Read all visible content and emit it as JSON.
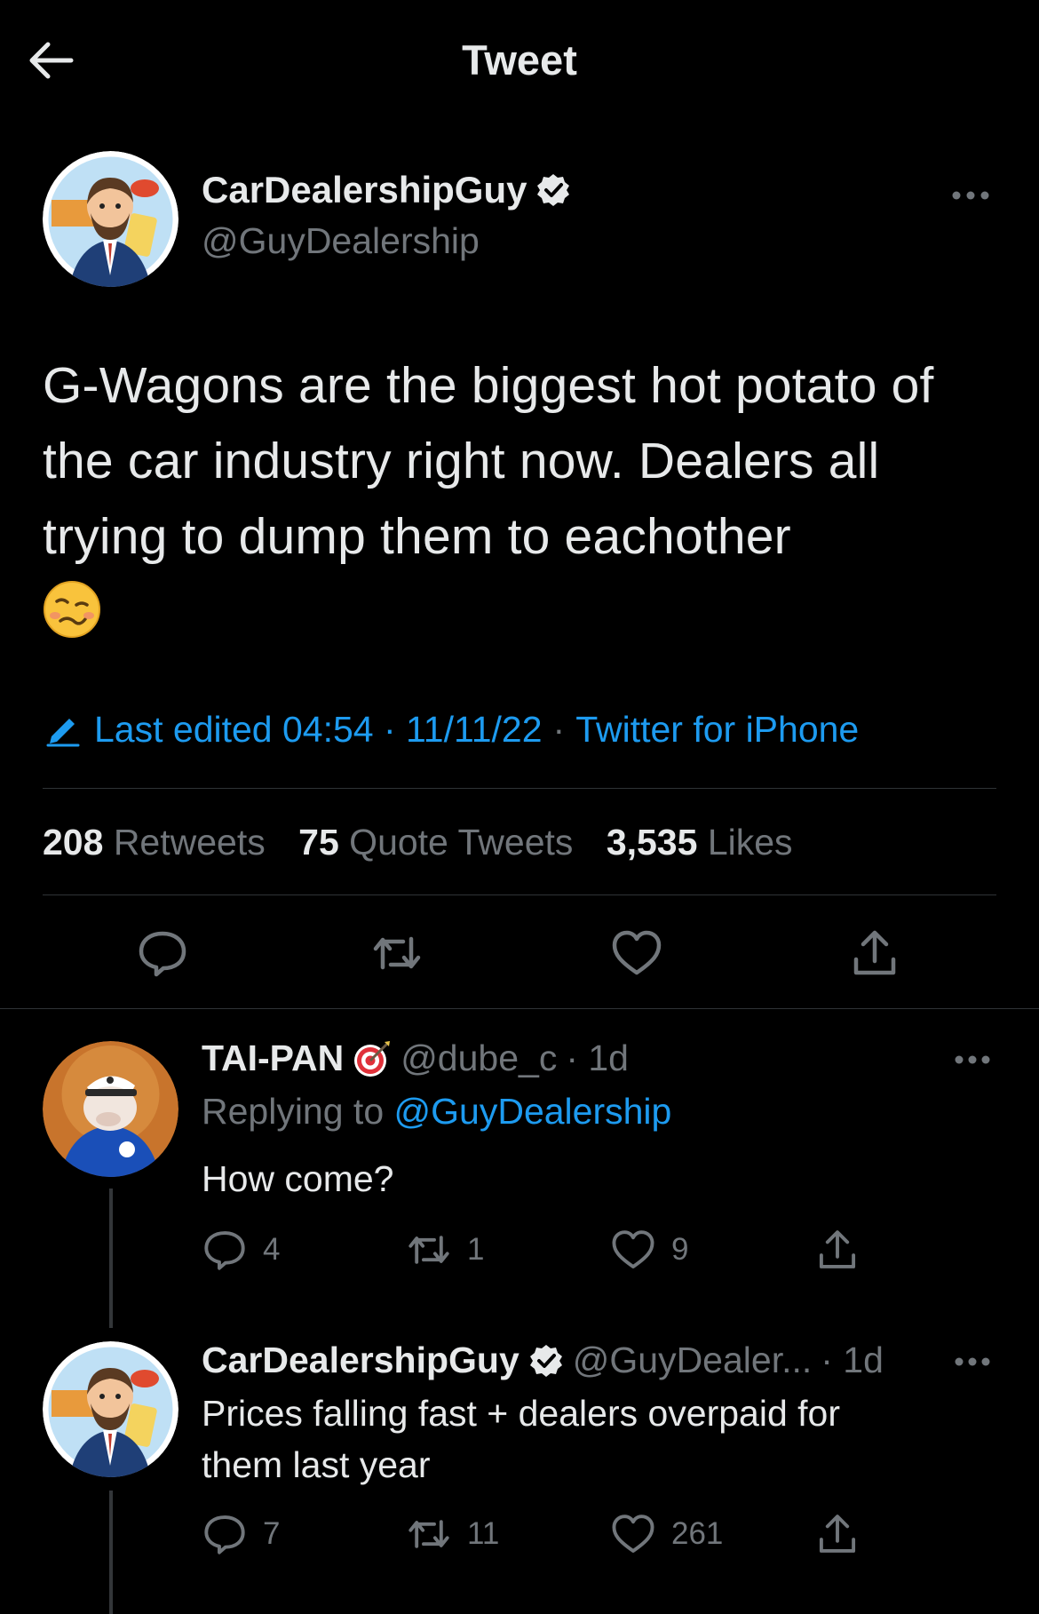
{
  "header": {
    "title": "Tweet"
  },
  "main_tweet": {
    "author_name": "CarDealershipGuy",
    "author_handle": "@GuyDealership",
    "verified": true,
    "text": "G-Wagons are the biggest hot potato of the car industry right now. Dealers all trying to dump them to eachother",
    "emoji": "woozy-face",
    "edited_label": "Last edited 04:54 · 11/11/22",
    "dot": "·",
    "source": "Twitter for iPhone",
    "stats": {
      "retweets_count": "208",
      "retweets_label": "Retweets",
      "quotes_count": "75",
      "quotes_label": "Quote Tweets",
      "likes_count": "3,535",
      "likes_label": "Likes"
    }
  },
  "replies": [
    {
      "name": "TAI-PAN",
      "badge_emoji": "🎯",
      "handle": "@dube_c",
      "time": "· 1d",
      "replying_prefix": "Replying to",
      "replying_to": "@GuyDealership",
      "text": "How come?",
      "reply_count": "4",
      "retweet_count": "1",
      "like_count": "9"
    },
    {
      "name": "CarDealershipGuy",
      "verified": true,
      "handle": "@GuyDealer...",
      "time": "· 1d",
      "text": "Prices falling fast + dealers overpaid for them last year",
      "reply_count": "7",
      "retweet_count": "11",
      "like_count": "261"
    }
  ],
  "colors": {
    "background": "#000000",
    "text": "#e7e9ea",
    "secondary": "#71767b",
    "accent": "#1d9bf0",
    "divider": "#2f3336"
  }
}
